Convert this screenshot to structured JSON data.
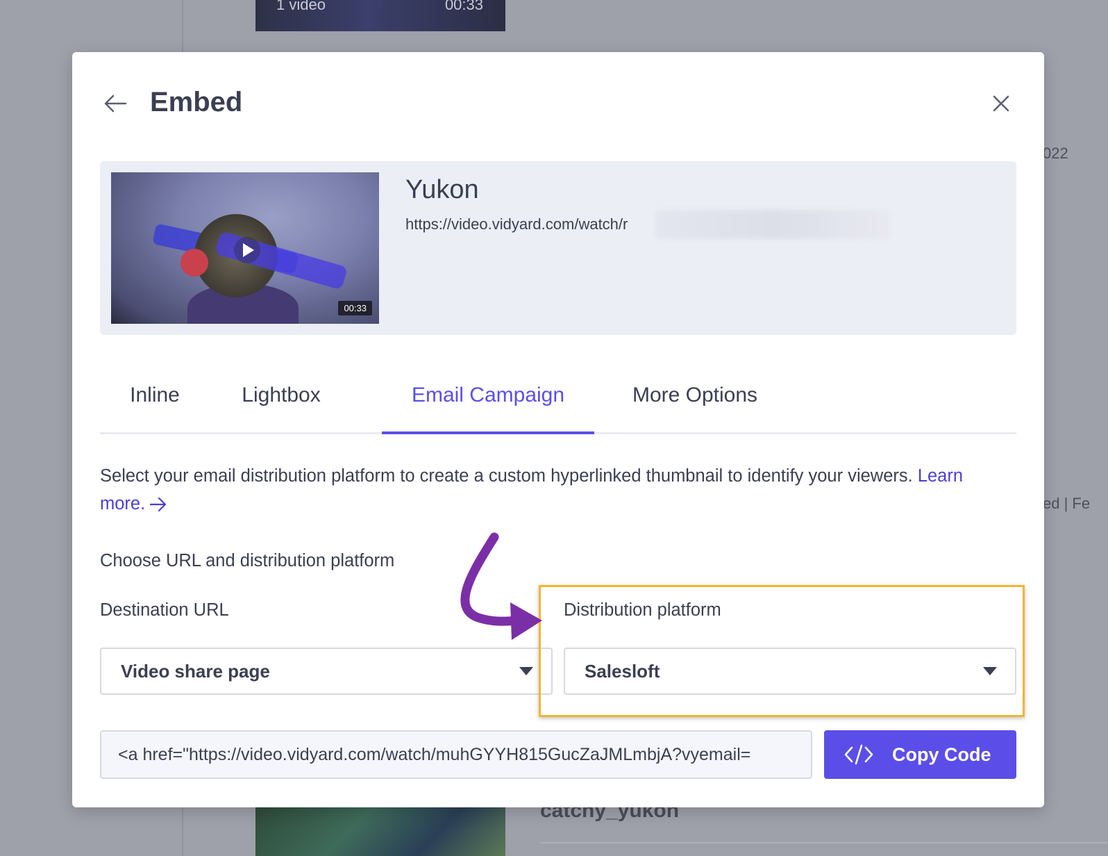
{
  "background": {
    "top_thumb_playlist": "1 video",
    "top_thumb_duration": "00:33",
    "year_fragment": "022",
    "filter_fragment": "ed   |   Fe",
    "bottom_video_title": "catchy_yukon"
  },
  "modal": {
    "title": "Embed",
    "back_icon": "arrow-left-icon",
    "close_icon": "close-icon"
  },
  "video": {
    "name": "Yukon",
    "url": "https://video.vidyard.com/watch/r",
    "duration": "00:33",
    "play_icon": "play-icon"
  },
  "tabs": [
    {
      "label": "Inline",
      "active": false
    },
    {
      "label": "Lightbox",
      "active": false
    },
    {
      "label": "Email Campaign",
      "active": true
    },
    {
      "label": "More Options",
      "active": false
    }
  ],
  "email_campaign": {
    "description": "Select your email distribution platform to create a custom hyperlinked thumbnail to identify your viewers.",
    "learn_more": "Learn more.",
    "section_heading": "Choose URL and distribution platform",
    "destination_url": {
      "label": "Destination URL",
      "value": "Video share page"
    },
    "distribution_platform": {
      "label": "Distribution platform",
      "value": "Salesloft"
    },
    "embed_code": "<a href=\"https://video.vidyard.com/watch/muhGYYH815GucZaJMLmbjA?vyemail=",
    "copy_button": "Copy Code"
  },
  "colors": {
    "accent": "#5b4ee8",
    "highlight": "#f2b633",
    "annotation_arrow": "#7b2fa6"
  }
}
